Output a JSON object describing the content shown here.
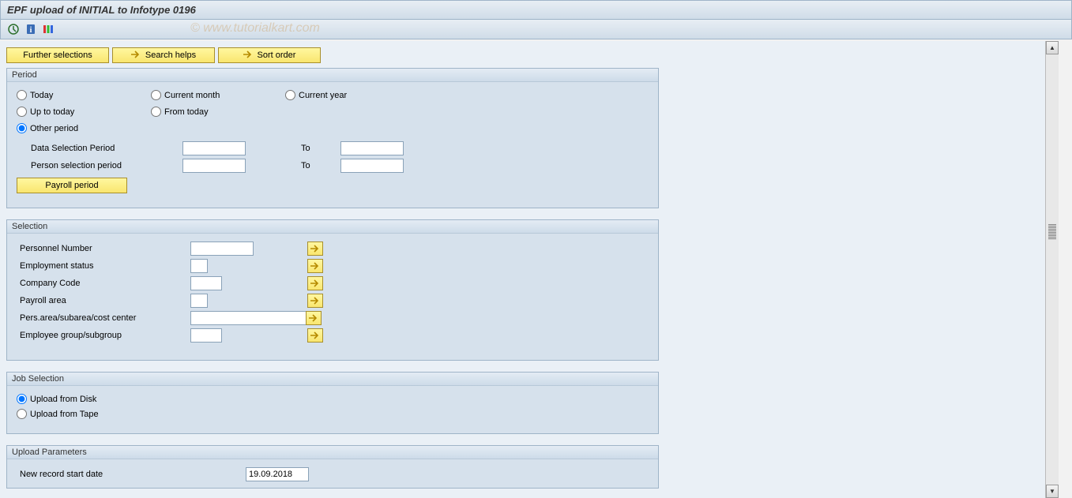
{
  "title": "EPF upload of INITIAL to Infotype 0196",
  "watermark": "© www.tutorialkart.com",
  "toolbar": {
    "icons": {
      "execute": "execute-icon",
      "info": "info-icon",
      "variants": "variants-icon"
    }
  },
  "buttons": {
    "further_selections": "Further selections",
    "search_helps": "Search helps",
    "sort_order": "Sort order",
    "payroll_period": "Payroll period"
  },
  "period": {
    "title": "Period",
    "radios": {
      "today": "Today",
      "current_month": "Current month",
      "current_year": "Current year",
      "up_to_today": "Up to today",
      "from_today": "From today",
      "other_period": "Other period"
    },
    "selected": "other_period",
    "data_selection_label": "Data Selection Period",
    "person_selection_label": "Person selection period",
    "to_label": "To",
    "data_selection_from": "",
    "data_selection_to": "",
    "person_selection_from": "",
    "person_selection_to": ""
  },
  "selection": {
    "title": "Selection",
    "fields": {
      "personnel_number": {
        "label": "Personnel Number",
        "value": ""
      },
      "employment_status": {
        "label": "Employment status",
        "value": ""
      },
      "company_code": {
        "label": "Company Code",
        "value": ""
      },
      "payroll_area": {
        "label": "Payroll area",
        "value": ""
      },
      "pers_area": {
        "label": "Pers.area/subarea/cost center",
        "value": ""
      },
      "employee_group": {
        "label": "Employee group/subgroup",
        "value": ""
      }
    }
  },
  "job_selection": {
    "title": "Job Selection",
    "radios": {
      "upload_disk": "Upload from Disk",
      "upload_tape": "Upload from Tape"
    },
    "selected": "upload_disk"
  },
  "upload_params": {
    "title": "Upload Parameters",
    "new_record_label": "New record start date",
    "new_record_value": "19.09.2018"
  }
}
